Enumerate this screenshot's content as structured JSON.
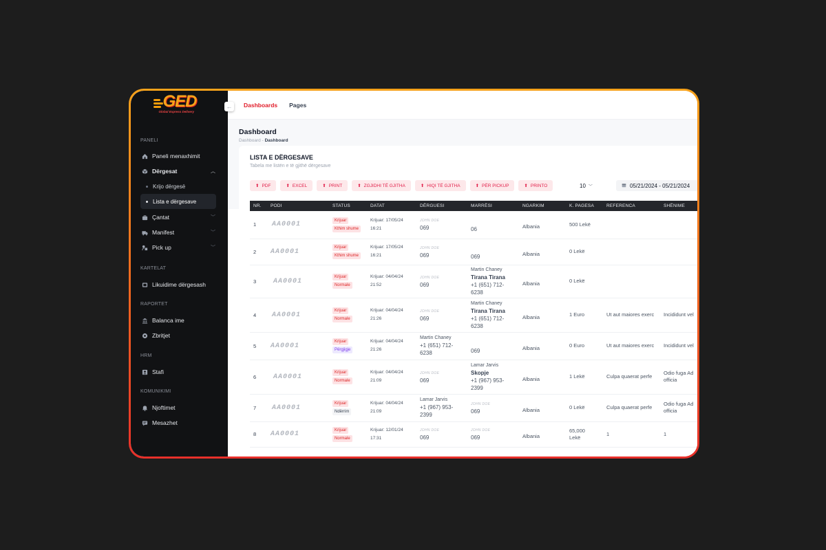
{
  "brand": {
    "logo_text": "GED",
    "tagline": "Global Express Delivery"
  },
  "sidebar": {
    "sections": [
      {
        "title": "PANELI"
      },
      {
        "title": "KARTELAT"
      },
      {
        "title": "RAPORTET"
      },
      {
        "title": "HRM"
      },
      {
        "title": "KOMUNIKIMI"
      }
    ],
    "items": [
      {
        "label": "Paneli menaxhimit",
        "icon": "home-icon"
      },
      {
        "label": "Dërgesat",
        "icon": "box-icon"
      },
      {
        "label": "Krijo dërgesë"
      },
      {
        "label": "Lista e dërgesave"
      },
      {
        "label": "Çantat",
        "icon": "bag-icon"
      },
      {
        "label": "Manifest",
        "icon": "truck-icon"
      },
      {
        "label": "Pick up",
        "icon": "pickup-icon"
      },
      {
        "label": "Likuidime dërgesash",
        "icon": "card-icon"
      },
      {
        "label": "Balanca ime",
        "icon": "bank-icon"
      },
      {
        "label": "Zbritjet",
        "icon": "discount-icon"
      },
      {
        "label": "Stafi",
        "icon": "user-badge-icon"
      },
      {
        "label": "Njoftimet",
        "icon": "bell-icon"
      },
      {
        "label": "Mesazhet",
        "icon": "message-icon"
      }
    ]
  },
  "topbar": {
    "tabs": [
      "Dashboards",
      "Pages"
    ]
  },
  "page": {
    "title": "Dashboard",
    "breadcrumb": [
      "Dashboard",
      "Dashboard"
    ],
    "breadcrumb_sep": "-"
  },
  "card": {
    "title": "LISTA E DËRGESAVE",
    "subtitle": "Tabela me listën e të gjithë dërgesave",
    "buttons": [
      "PDF",
      "EXCEL",
      "PRINT",
      "ZGJIDHI TË GJITHA",
      "HIQI TË GJITHA",
      "PËR PICKUP",
      "PRINTO"
    ],
    "per_page": "10",
    "date_range": "05/21/2024 - 05/21/2024"
  },
  "table": {
    "headers": [
      "NR.",
      "PODI",
      "STATUS",
      "DATAT",
      "DËRGUESI",
      "MARRËSI",
      "NGARKIM",
      "K. PAGESA",
      "REFERENCA",
      "SHËNIME"
    ],
    "rows": [
      {
        "nr": "1",
        "podi": "AA0001",
        "status": [
          "Krijuar",
          "Kthim shume"
        ],
        "status_colors": [
          "red",
          "red"
        ],
        "date": "Krijuar: 17/05/24",
        "time": "16:21",
        "sender": {
          "top": "JOHN DOE",
          "name": "",
          "phone": "069"
        },
        "receiver": {
          "top": "",
          "name": "",
          "city": "",
          "phone": "06"
        },
        "load": "Albania",
        "payment": "500 Lekë",
        "ref": "",
        "notes": ""
      },
      {
        "nr": "2",
        "podi": "AA0001",
        "status": [
          "Krijuar",
          "Kthim shume"
        ],
        "status_colors": [
          "red",
          "red"
        ],
        "date": "Krijuar: 17/05/24",
        "time": "16:21",
        "sender": {
          "top": "JOHN DOE",
          "name": "",
          "phone": "069"
        },
        "receiver": {
          "top": "",
          "name": "",
          "city": "",
          "phone": "069"
        },
        "load": "Albania",
        "payment": "0 Lekë",
        "ref": "",
        "notes": ""
      },
      {
        "nr": "3",
        "podi": "AA0001",
        "status": [
          "Krijuar",
          "Normale"
        ],
        "status_colors": [
          "red",
          "red"
        ],
        "date": "Krijuar: 04/04/24",
        "time": "21:52",
        "sender": {
          "top": "JOHN DOE",
          "name": "",
          "phone": "069"
        },
        "receiver": {
          "top": "",
          "name": "Martin Chaney",
          "city": "Tirana Tirana",
          "phone": "+1 (651) 712-6238"
        },
        "load": "Albania",
        "payment": "0 Lekë",
        "ref": "",
        "notes": ""
      },
      {
        "nr": "4",
        "podi": "AA0001",
        "status": [
          "Krijuar",
          "Normale"
        ],
        "status_colors": [
          "red",
          "red"
        ],
        "date": "Krijuar: 04/04/24",
        "time": "21:26",
        "sender": {
          "top": "JOHN DOE",
          "name": "",
          "phone": "069"
        },
        "receiver": {
          "top": "",
          "name": "Martin Chaney",
          "city": "Tirana Tirana",
          "phone": "+1 (651) 712-6238"
        },
        "load": "Albania",
        "payment": "1 Euro",
        "ref": "Ut aut maiores exerc",
        "notes": "Incididunt vel"
      },
      {
        "nr": "5",
        "podi": "AA0001",
        "status": [
          "Krijuar",
          "Përgjigje"
        ],
        "status_colors": [
          "red",
          "purple"
        ],
        "date": "Krijuar: 04/04/24",
        "time": "21:26",
        "sender": {
          "top": "",
          "name": "Martin Chaney",
          "phone": "+1 (651) 712-6238"
        },
        "receiver": {
          "top": "",
          "name": "",
          "city": "",
          "phone": "069"
        },
        "load": "Albania",
        "payment": "0 Euro",
        "ref": "Ut aut maiores exerc",
        "notes": "Incididunt vel"
      },
      {
        "nr": "6",
        "podi": "AA0001",
        "status": [
          "Krijuar",
          "Normale"
        ],
        "status_colors": [
          "red",
          "red"
        ],
        "date": "Krijuar: 04/04/24",
        "time": "21:09",
        "sender": {
          "top": "JOHN DOE",
          "name": "",
          "phone": "069"
        },
        "receiver": {
          "top": "",
          "name": "Lamar Jarvis",
          "city": "Skopje",
          "phone": "+1 (967) 953-2399"
        },
        "load": "Albania",
        "payment": "1 Lekë",
        "ref": "Culpa quaerat perfe",
        "notes": "Odio fuga Ad officia"
      },
      {
        "nr": "7",
        "podi": "AA0001",
        "status": [
          "Krijuar",
          "Ndërrim"
        ],
        "status_colors": [
          "red",
          "gray"
        ],
        "date": "Krijuar: 04/04/24",
        "time": "21:09",
        "sender": {
          "top": "",
          "name": "Lamar Jarvis",
          "phone": "+1 (967) 953-2399"
        },
        "receiver": {
          "top": "JOHN DOE",
          "name": "",
          "city": "",
          "phone": "069"
        },
        "load": "Albania",
        "payment": "0 Lekë",
        "ref": "Culpa quaerat perfe",
        "notes": "Odio fuga Ad officia"
      },
      {
        "nr": "8",
        "podi": "AA0001",
        "status": [
          "Krijuar",
          "Normale"
        ],
        "status_colors": [
          "red",
          "red"
        ],
        "date": "Krijuar: 12/01/24",
        "time": "17:31",
        "sender": {
          "top": "JOHN DOE",
          "name": "",
          "phone": "069"
        },
        "receiver": {
          "top": "JOHN DOE",
          "name": "",
          "city": "",
          "phone": "069"
        },
        "load": "Albania",
        "payment": "65,000 Lekë",
        "ref": "1",
        "notes": "1"
      }
    ]
  },
  "colors": {
    "accent": "#e11d2a",
    "sidebar_bg": "#111214",
    "frame_top": "#f7a21b",
    "frame_bottom": "#e8302a"
  }
}
